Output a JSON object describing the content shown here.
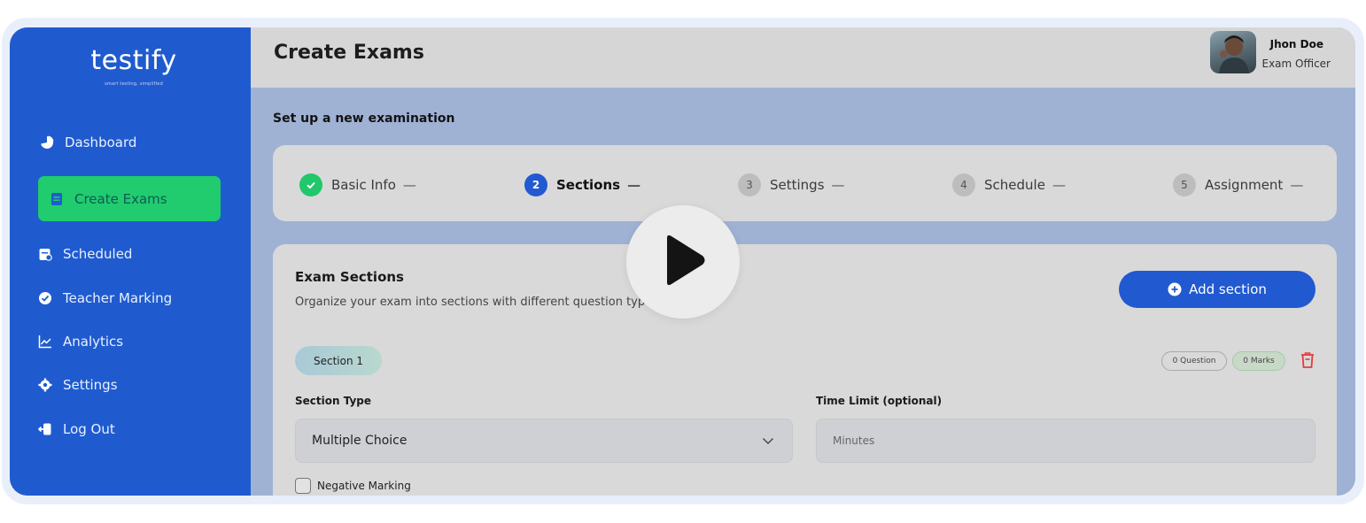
{
  "brand": {
    "logo": "testify",
    "tagline": "smart testing, simplified"
  },
  "sidebar": {
    "items": [
      {
        "label": "Dashboard",
        "icon": "pie-chart-icon"
      },
      {
        "label": "Create Exams",
        "icon": "document-icon",
        "active": true
      },
      {
        "label": "Scheduled",
        "icon": "calendar-icon"
      },
      {
        "label": "Teacher Marking",
        "icon": "check-circle-icon"
      },
      {
        "label": "Analytics",
        "icon": "chart-line-icon"
      },
      {
        "label": "Settings",
        "icon": "gear-icon"
      },
      {
        "label": "Log Out",
        "icon": "logout-icon"
      }
    ]
  },
  "header": {
    "title": "Create Exams",
    "user": {
      "name": "Jhon Doe",
      "role": "Exam Officer"
    }
  },
  "main": {
    "subtitle": "Set up a new examination",
    "steps": [
      {
        "number": "1",
        "label": "Basic Info",
        "status": "done"
      },
      {
        "number": "2",
        "label": "Sections",
        "status": "current"
      },
      {
        "number": "3",
        "label": "Settings",
        "status": "pending"
      },
      {
        "number": "4",
        "label": "Schedule",
        "status": "pending"
      },
      {
        "number": "5",
        "label": "Assignment",
        "status": "pending"
      }
    ],
    "step_separator": "—",
    "sections_card": {
      "title": "Exam Sections",
      "description": "Organize your exam into sections with different question types",
      "add_button": "Add section",
      "section": {
        "name": "Section 1",
        "question_badge": "0 Question",
        "marks_badge": "0 Marks",
        "type_label": "Section Type",
        "type_value": "Multiple Choice",
        "time_label": "Time Limit (optional)",
        "time_placeholder": "Minutes",
        "negative_marking_label": "Negative Marking"
      }
    }
  },
  "overlay": {
    "icon": "play-icon"
  },
  "colors": {
    "sidebar": "#1f5bcf",
    "active_item": "#20cc6e",
    "primary_button": "#2159d0",
    "done_step": "#20c76b"
  }
}
